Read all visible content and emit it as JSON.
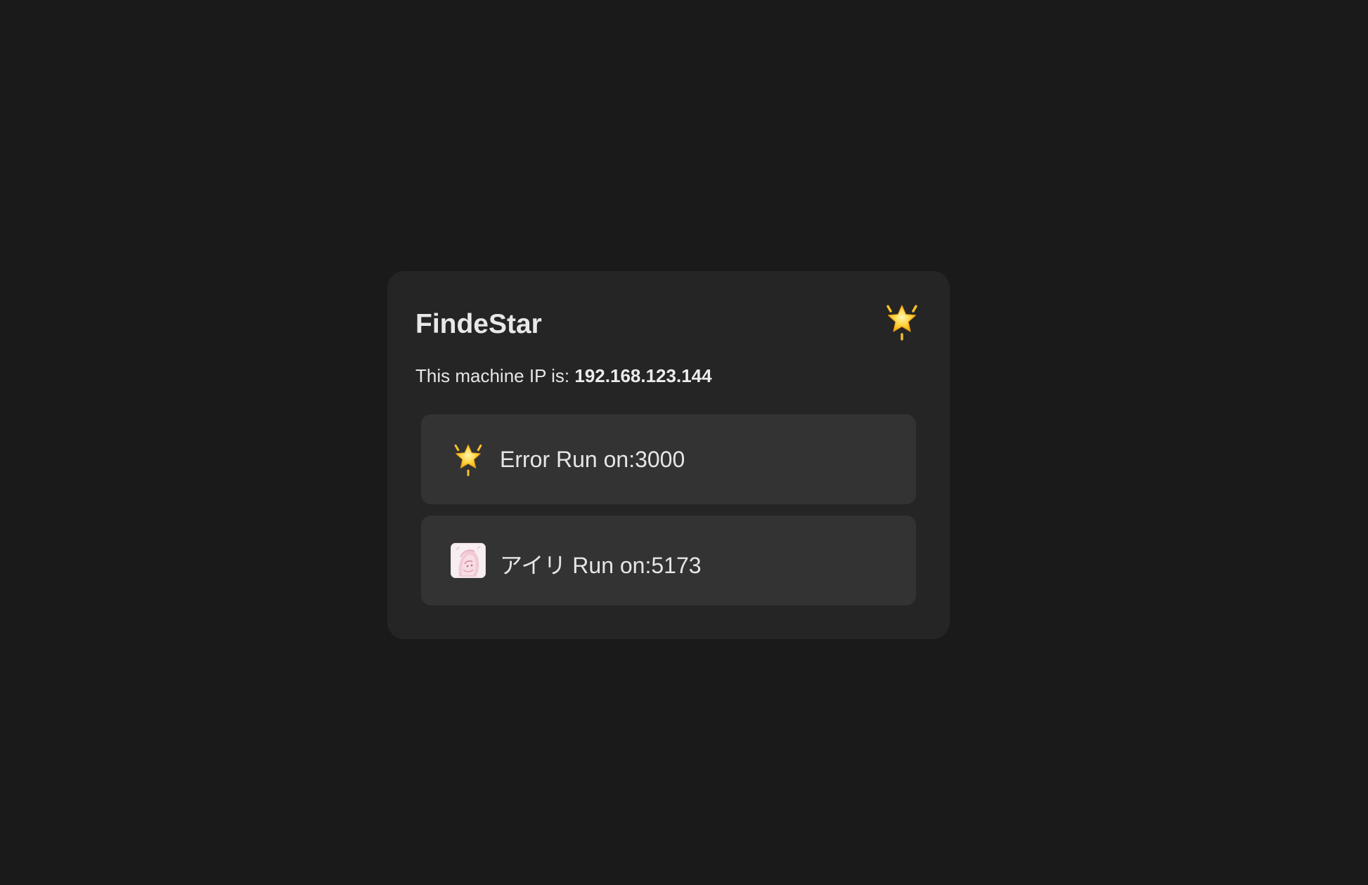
{
  "card": {
    "title": "FindeStar",
    "title_icon": "glowing-star-icon",
    "ip_prefix": "This machine IP is: ",
    "ip_value": "192.168.123.144"
  },
  "services": [
    {
      "icon": "glowing-star-icon",
      "label": "Error Run on:3000"
    },
    {
      "icon": "anime-avatar-icon",
      "label": "アイリ Run on:5173"
    }
  ],
  "colors": {
    "background": "#1a1a1a",
    "card": "#252525",
    "service_item": "#333333",
    "text": "#e6e6e6",
    "star": "#f7c52a"
  }
}
